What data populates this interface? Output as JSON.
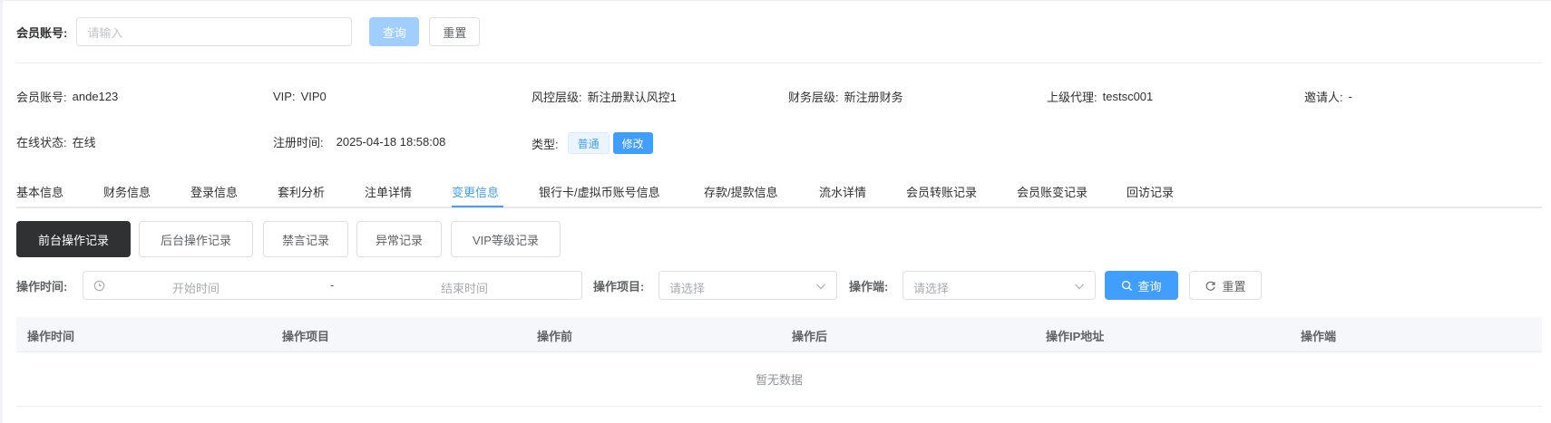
{
  "search": {
    "account_label": "会员账号:",
    "account_placeholder": "请输入",
    "query_label": "查询",
    "reset_label": "重置"
  },
  "info": {
    "account": {
      "label": "会员账号:",
      "value": "ande123"
    },
    "vip": {
      "label": "VIP:",
      "value": "VIP0"
    },
    "risk": {
      "label": "风控层级:",
      "value": "新注册默认风控1"
    },
    "finance": {
      "label": "财务层级:",
      "value": "新注册财务"
    },
    "agent": {
      "label": "上级代理:",
      "value": "testsc001"
    },
    "inviter": {
      "label": "邀请人:",
      "value": "-"
    },
    "online": {
      "label": "在线状态:",
      "value": "在线"
    },
    "register_time": {
      "label": "注册时间:",
      "value": "2025-04-18 18:58:08"
    },
    "type": {
      "label": "类型:",
      "tag": "普通",
      "edit": "修改"
    }
  },
  "tabs": [
    {
      "label": "基本信息"
    },
    {
      "label": "财务信息"
    },
    {
      "label": "登录信息"
    },
    {
      "label": "套利分析"
    },
    {
      "label": "注单详情"
    },
    {
      "label": "变更信息"
    },
    {
      "label": "银行卡/虚拟币账号信息"
    },
    {
      "label": "存款/提款信息"
    },
    {
      "label": "流水详情"
    },
    {
      "label": "会员转账记录"
    },
    {
      "label": "会员账变记录"
    },
    {
      "label": "回访记录"
    }
  ],
  "active_tab": "变更信息",
  "sub_tabs": [
    {
      "label": "前台操作记录"
    },
    {
      "label": "后台操作记录"
    },
    {
      "label": "禁言记录"
    },
    {
      "label": "异常记录"
    },
    {
      "label": "VIP等级记录"
    }
  ],
  "active_sub_tab": "前台操作记录",
  "filters": {
    "time_label": "操作时间:",
    "start_placeholder": "开始时间",
    "range_separator": "-",
    "end_placeholder": "结束时间",
    "item_label": "操作项目:",
    "item_placeholder": "请选择",
    "client_label": "操作端:",
    "client_placeholder": "请选择",
    "query_label": "查询",
    "reset_label": "重置"
  },
  "table": {
    "columns": [
      "操作时间",
      "操作项目",
      "操作前",
      "操作后",
      "操作IP地址",
      "操作端"
    ],
    "empty_text": "暂无数据"
  },
  "colors": {
    "primary": "#409eff",
    "primary_disabled": "#a0cfff",
    "active_sub_tab": "#303133"
  },
  "icons": {
    "clock": "clock-icon",
    "chevron": "chevron-down-icon",
    "search": "search-icon",
    "refresh": "refresh-icon"
  }
}
